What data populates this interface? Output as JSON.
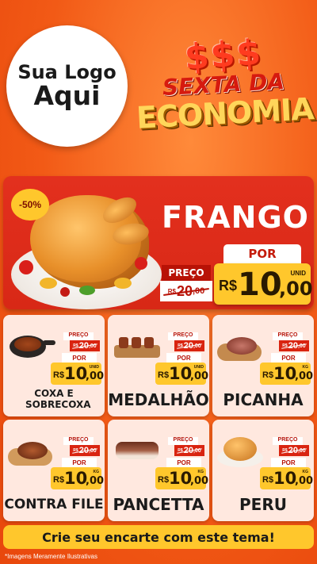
{
  "logo": {
    "line1": "Sua Logo",
    "line2": "Aqui"
  },
  "promo": {
    "symbols": "$$$",
    "line1": "SEXTA DA",
    "line2": "ECONOMIA"
  },
  "featured": {
    "discount_badge": "-50%",
    "name": "FRANGO",
    "por_label": "POR",
    "preco_label": "PREÇO",
    "old_price": {
      "currency": "R$",
      "int": "20",
      "dec": ",00"
    },
    "new_price": {
      "currency": "R$",
      "int": "10",
      "dec": ",00",
      "unit": "UNID"
    }
  },
  "products": [
    {
      "name": "COXA E SOBRECOXA",
      "icon": "pan-chicken-icon",
      "preco_label": "PREÇO",
      "por_label": "POR",
      "old": {
        "currency": "R$",
        "int": "20",
        "dec": ",00"
      },
      "new": {
        "currency": "R$",
        "int": "10",
        "dec": ",00",
        "unit": "UNID"
      }
    },
    {
      "name": "MEDALHÃO",
      "icon": "skewers-icon",
      "preco_label": "PREÇO",
      "por_label": "POR",
      "old": {
        "currency": "R$",
        "int": "20",
        "dec": ",00"
      },
      "new": {
        "currency": "R$",
        "int": "10",
        "dec": ",00",
        "unit": "UNID"
      }
    },
    {
      "name": "PICANHA",
      "icon": "steak-board-icon",
      "preco_label": "PREÇO",
      "por_label": "POR",
      "old": {
        "currency": "R$",
        "int": "20",
        "dec": ",00"
      },
      "new": {
        "currency": "R$",
        "int": "10",
        "dec": ",00",
        "unit": "KG"
      }
    },
    {
      "name": "CONTRA FILE",
      "icon": "steak-icon",
      "preco_label": "PREÇO",
      "por_label": "POR",
      "old": {
        "currency": "R$",
        "int": "20",
        "dec": ",00"
      },
      "new": {
        "currency": "R$",
        "int": "10",
        "dec": ",00",
        "unit": "KG"
      }
    },
    {
      "name": "PANCETTA",
      "icon": "pancetta-icon",
      "preco_label": "PREÇO",
      "por_label": "POR",
      "old": {
        "currency": "R$",
        "int": "20",
        "dec": ",00"
      },
      "new": {
        "currency": "R$",
        "int": "10",
        "dec": ",00",
        "unit": "KG"
      }
    },
    {
      "name": "PERU",
      "icon": "turkey-icon",
      "preco_label": "PREÇO",
      "por_label": "POR",
      "old": {
        "currency": "R$",
        "int": "20",
        "dec": ",00"
      },
      "new": {
        "currency": "R$",
        "int": "10",
        "dec": ",00",
        "unit": "KG"
      }
    }
  ],
  "cta": "Crie seu encarte com este tema!",
  "disclaimer": "*Imagens Meramente Ilustrativas",
  "colors": {
    "accent": "#ffc72c",
    "brand_red": "#e3301e",
    "background": "#f25a16"
  }
}
